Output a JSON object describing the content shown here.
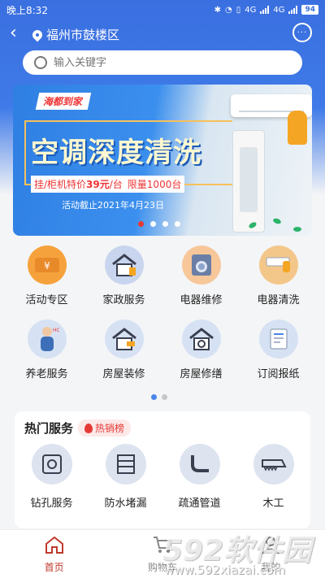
{
  "status_bar": {
    "time": "晚上8:32",
    "battery": "94",
    "net1": "4G",
    "net2": "4G"
  },
  "header": {
    "location": "福州市鼓楼区",
    "back_glyph": "‹",
    "message_glyph": "···"
  },
  "search": {
    "placeholder": "输入关键字"
  },
  "banner": {
    "brand": "海都到家",
    "title": "空调深度清洗",
    "price_text": "挂/柜机特价",
    "price": "39元",
    "unit": "/台",
    "limit": "限量1000台",
    "date": "活动截止2021年4月23日",
    "slides": 4,
    "active_slide": 0
  },
  "services": [
    {
      "label": "活动专区",
      "icon": "ticket-icon",
      "color": "#f6a23c"
    },
    {
      "label": "家政服务",
      "icon": "house-cleaning-icon",
      "color": "#c9d5ee"
    },
    {
      "label": "电器维修",
      "icon": "washing-machine-icon",
      "color": "#f7c79a"
    },
    {
      "label": "电器清洗",
      "icon": "air-conditioner-icon",
      "color": "#f3c78a"
    },
    {
      "label": "养老服务",
      "icon": "elderly-icon",
      "color": "#d6e2f3"
    },
    {
      "label": "房屋装修",
      "icon": "house-paint-icon",
      "color": "#d6e2f3"
    },
    {
      "label": "房屋修缮",
      "icon": "house-repair-icon",
      "color": "#d6e2f3"
    },
    {
      "label": "订阅报纸",
      "icon": "newspaper-icon",
      "color": "#d6e2f3"
    }
  ],
  "service_pages": 2,
  "hot": {
    "title": "热门服务",
    "badge": "热销榜",
    "items": [
      {
        "label": "钻孔服务",
        "icon": "safe-drill-icon"
      },
      {
        "label": "防水堵漏",
        "icon": "waterproof-icon"
      },
      {
        "label": "疏通管道",
        "icon": "pipe-icon"
      },
      {
        "label": "木工",
        "icon": "saw-icon"
      }
    ]
  },
  "nav": [
    {
      "label": "首页",
      "icon": "home-icon",
      "active": true
    },
    {
      "label": "购物车",
      "icon": "cart-icon",
      "active": false
    },
    {
      "label": "我的",
      "icon": "user-icon",
      "active": false
    }
  ],
  "watermark": {
    "big": "592软件园",
    "url": "www.592xiazai.com"
  }
}
